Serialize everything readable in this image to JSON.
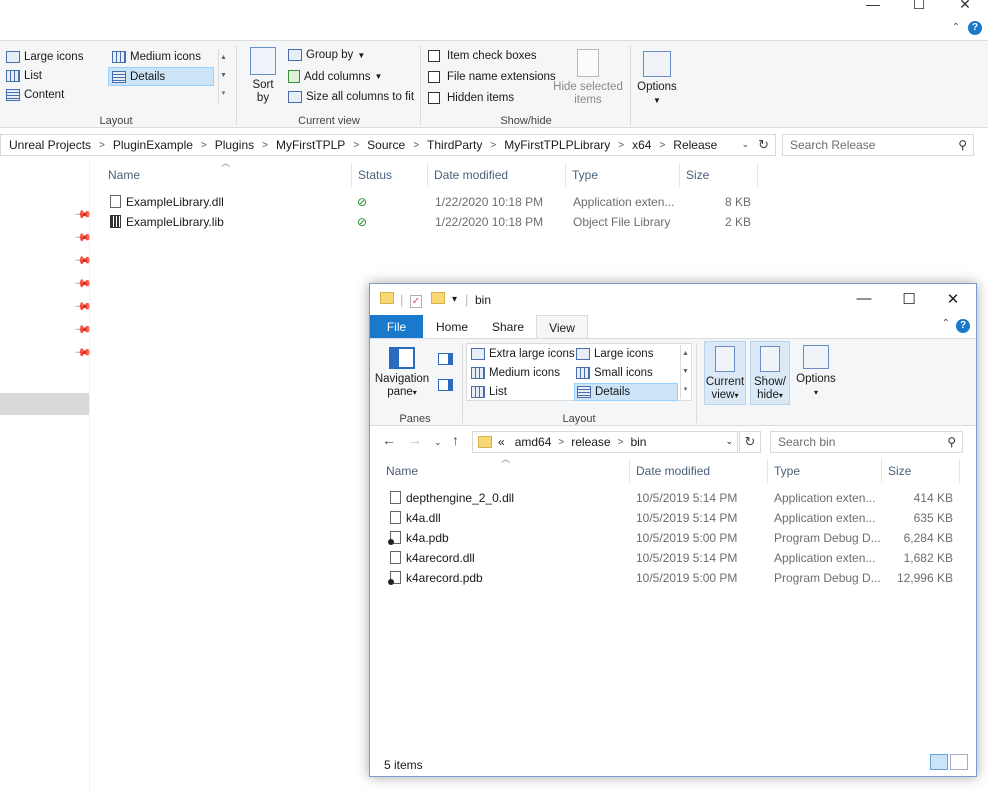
{
  "back_window": {
    "window_controls": [
      "—",
      "☐",
      "✕"
    ],
    "help_label": "?",
    "layout_group": {
      "label": "Layout",
      "items": [
        "Large icons",
        "Medium icons",
        "List",
        "Details",
        "Content"
      ],
      "selected": "Details"
    },
    "current_view_group": {
      "label": "Current view",
      "sort_by": "Sort\nby",
      "group_by": "Group by",
      "add_columns": "Add columns",
      "size_all_columns": "Size all columns to fit"
    },
    "show_hide_group": {
      "label": "Show/hide",
      "item_check_boxes": "Item check boxes",
      "file_name_extensions": "File name extensions",
      "hidden_items": "Hidden items",
      "hide_selected": "Hide selected\nitems",
      "options": "Options"
    },
    "breadcrumb": [
      "Unreal Projects",
      "PluginExample",
      "Plugins",
      "MyFirstTPLP",
      "Source",
      "ThirdParty",
      "MyFirstTPLPLibrary",
      "x64",
      "Release"
    ],
    "search_placeholder": "Search Release",
    "columns": [
      "Name",
      "Status",
      "Date modified",
      "Type",
      "Size"
    ],
    "files": [
      {
        "name": "ExampleLibrary.dll",
        "date": "1/22/2020 10:18 PM",
        "type": "Application exten...",
        "size": "8 KB",
        "icon": "dll-icon"
      },
      {
        "name": "ExampleLibrary.lib",
        "date": "1/22/2020 10:18 PM",
        "type": "Object File Library",
        "size": "2 KB",
        "icon": "lib-icon"
      }
    ]
  },
  "front_window": {
    "title": "bin",
    "tabs": [
      "File",
      "Home",
      "Share",
      "View"
    ],
    "active_tab": "View",
    "panes_group": {
      "label": "Panes",
      "navigation_pane": "Navigation\npane"
    },
    "layout_group": {
      "label": "Layout",
      "items": [
        "Extra large icons",
        "Large icons",
        "Medium icons",
        "Small icons",
        "List",
        "Details"
      ],
      "selected": "Details"
    },
    "current_view": "Current\nview",
    "show_hide": "Show/\nhide",
    "options": "Options",
    "breadcrumb": [
      "amd64",
      "release",
      "bin"
    ],
    "breadcrumb_prefix": "«",
    "search_placeholder": "Search bin",
    "columns": [
      "Name",
      "Date modified",
      "Type",
      "Size"
    ],
    "files": [
      {
        "name": "depthengine_2_0.dll",
        "date": "10/5/2019 5:14 PM",
        "type": "Application exten...",
        "size": "414 KB",
        "icon": "dll-icon"
      },
      {
        "name": "k4a.dll",
        "date": "10/5/2019 5:14 PM",
        "type": "Application exten...",
        "size": "635 KB",
        "icon": "dll-icon"
      },
      {
        "name": "k4a.pdb",
        "date": "10/5/2019 5:00 PM",
        "type": "Program Debug D...",
        "size": "6,284 KB",
        "icon": "pdb-icon"
      },
      {
        "name": "k4arecord.dll",
        "date": "10/5/2019 5:14 PM",
        "type": "Application exten...",
        "size": "1,682 KB",
        "icon": "dll-icon"
      },
      {
        "name": "k4arecord.pdb",
        "date": "10/5/2019 5:00 PM",
        "type": "Program Debug D...",
        "size": "12,996 KB",
        "icon": "pdb-icon"
      }
    ],
    "status": "5 items",
    "window_controls": [
      "—",
      "☐",
      "✕"
    ]
  }
}
